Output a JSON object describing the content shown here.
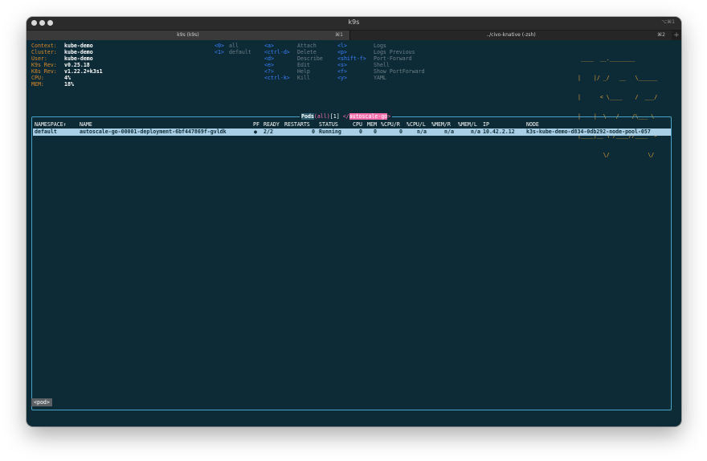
{
  "window": {
    "title": "k9s",
    "shortcut": "⌥⌘1",
    "tabs": [
      {
        "label": "k9s (k9s)",
        "key": "⌘1"
      },
      {
        "label": "../civo-knative (-zsh)",
        "key": "⌘2"
      }
    ],
    "add_tab": "+"
  },
  "info": [
    {
      "label": "Context:",
      "value": "kube-demo"
    },
    {
      "label": "Cluster:",
      "value": "kube-demo"
    },
    {
      "label": "User:",
      "value": "kube-demo"
    },
    {
      "label": "K9s Rev:",
      "value": "v0.25.18"
    },
    {
      "label": "K8s Rev:",
      "value": "v1.22.2+k3s1"
    },
    {
      "label": "CPU:",
      "value": "4%"
    },
    {
      "label": "MEM:",
      "value": "18%"
    }
  ],
  "namespaces": [
    {
      "key": "<0>",
      "label": "all"
    },
    {
      "key": "<1>",
      "label": "default"
    }
  ],
  "shortcuts_a": [
    {
      "key": "<a>",
      "label": "Attach"
    },
    {
      "key": "<ctrl-d>",
      "label": "Delete"
    },
    {
      "key": "<d>",
      "label": "Describe"
    },
    {
      "key": "<e>",
      "label": "Edit"
    },
    {
      "key": "<?>",
      "label": "Help"
    },
    {
      "key": "<ctrl-k>",
      "label": "Kill"
    }
  ],
  "shortcuts_b": [
    {
      "key": "<l>",
      "label": "Logs"
    },
    {
      "key": "<p>",
      "label": "Logs Previous"
    },
    {
      "key": "<shift-f>",
      "label": "Port-Forward"
    },
    {
      "key": "<s>",
      "label": "Shell"
    },
    {
      "key": "<f>",
      "label": "Show PortForward"
    },
    {
      "key": "<y>",
      "label": "YAML"
    }
  ],
  "logo": [
    " ____  __.________",
    "|    |/ _/   __   \\______",
    "|      < \\____    /  ___/",
    "|    |  \\   /    /\\___ \\",
    "|____|__ \\ /____//____  >",
    "        \\/            \\/"
  ],
  "view": {
    "resource": "Pods",
    "scope": "all",
    "count": "[1]",
    "filter_prefix": "</",
    "filter": "autoscale-go",
    "filter_suffix": ">"
  },
  "table": {
    "columns": {
      "namespace": "NAMESPACE↑",
      "name": "NAME",
      "pf": "PF",
      "ready": "READY",
      "restarts": "RESTARTS",
      "status": "STATUS",
      "cpu": "CPU",
      "mem": "MEM",
      "pcpu_r": "%CPU/R",
      "pcpu_l": "%CPU/L",
      "pmem_r": "%MEM/R",
      "pmem_l": "%MEM/L",
      "ip": "IP",
      "node": "NODE"
    },
    "rows": [
      {
        "namespace": "default",
        "name": "autoscale-go-00001-deployment-6bf447869f-gvldk",
        "pf": "●",
        "ready": "2/2",
        "restarts": "0",
        "status": "Running",
        "cpu": "0",
        "mem": "0",
        "pcpu_r": "0",
        "pcpu_l": "n/a",
        "pmem_r": "n/a",
        "pmem_l": "n/a",
        "ip": "10.42.2.12",
        "node": "k3s-kube-demo-d834-0db292-node-pool-057"
      }
    ]
  },
  "breadcrumb": "<pod>",
  "colors": {
    "terminal_bg": "#0d2b36",
    "label": "#d98a2b",
    "key": "#3a82ff",
    "hint": "#6f7f87",
    "frame": "#4aa3c5",
    "selected_row": "#a9cfe6",
    "logo": "#e7a238",
    "filter": "#ff6fb0"
  }
}
